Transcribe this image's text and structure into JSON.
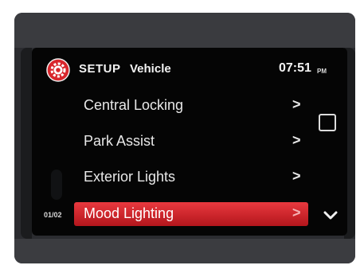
{
  "header": {
    "icon": "gear-icon",
    "section": "SETUP",
    "subsection": "Vehicle",
    "time": "07:51",
    "ampm": "PM",
    "accent_color": "#d8262c"
  },
  "menu": {
    "items": [
      {
        "label": "Central Locking",
        "chevron": ">"
      },
      {
        "label": "Park Assist",
        "chevron": ">"
      },
      {
        "label": "Exterior Lights",
        "chevron": ">"
      },
      {
        "label": "Mood Lighting",
        "chevron": ">"
      }
    ],
    "selected_index": 3,
    "selected_color": "#d8262c"
  },
  "page_indicator": "01/02",
  "controls": {
    "square_button_icon": "square-icon",
    "scroll_down_icon": "chevron-down-icon"
  }
}
